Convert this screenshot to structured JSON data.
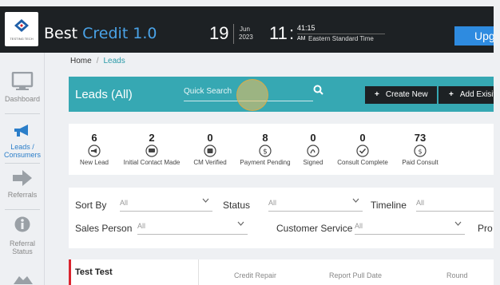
{
  "header": {
    "logo_caption": "TESTING TECH",
    "title_plain": "Best ",
    "title_accent": "Credit 1.0",
    "date_day": "19",
    "date_month": "Jun",
    "date_year": "2023",
    "time_hour": "11",
    "time_minutes": "41:15",
    "time_ampm": "AM",
    "time_zone": "Eastern Standard Time",
    "upgrade_label": "Upg"
  },
  "sidebar": {
    "items": [
      {
        "label": "Dashboard",
        "icon": "monitor-icon"
      },
      {
        "label": "Leads / Consumers",
        "icon": "megaphone-icon"
      },
      {
        "label": "Referrals",
        "icon": "arrow-right-icon"
      },
      {
        "label": "Referral Status",
        "icon": "info-icon"
      }
    ]
  },
  "breadcrumb": {
    "home": "Home",
    "separator": "/",
    "current": "Leads"
  },
  "toolbar": {
    "title": "Leads (All)",
    "search_placeholder": "Quick Search",
    "create_label": "Create New",
    "add_label": "Add Exisit"
  },
  "stats": [
    {
      "value": "6",
      "label": "New Lead",
      "icon": "megaphone-icon"
    },
    {
      "value": "2",
      "label": "Initial Contact Made",
      "icon": "chat-icon"
    },
    {
      "value": "0",
      "label": "CM Verified",
      "icon": "verified-icon"
    },
    {
      "value": "8",
      "label": "Payment Pending",
      "icon": "dollar-icon"
    },
    {
      "value": "0",
      "label": "Signed",
      "icon": "signature-icon"
    },
    {
      "value": "0",
      "label": "Consult Complete",
      "icon": "check-icon"
    },
    {
      "value": "73",
      "label": "Paid Consult",
      "icon": "paid-icon"
    }
  ],
  "filters": {
    "sort_by": {
      "label": "Sort By",
      "value": "All"
    },
    "status": {
      "label": "Status",
      "value": "All"
    },
    "timeline": {
      "label": "Timeline",
      "value": "All"
    },
    "sales_person": {
      "label": "Sales Person",
      "value": "All"
    },
    "customer_service": {
      "label": "Customer Service",
      "value": "All"
    },
    "cut_label": "Pro"
  },
  "lead_row": {
    "name": "Test Test",
    "col1": "Credit Repair",
    "col2": "Report Pull Date",
    "col3": "Round"
  },
  "colors": {
    "header_bg": "#1d2124",
    "accent_blue": "#4aa3e8",
    "teal": "#36a8b3",
    "button_dark": "#1d2124",
    "upgrade_blue": "#2e8be0",
    "lead_marker_red": "#d9252f"
  }
}
